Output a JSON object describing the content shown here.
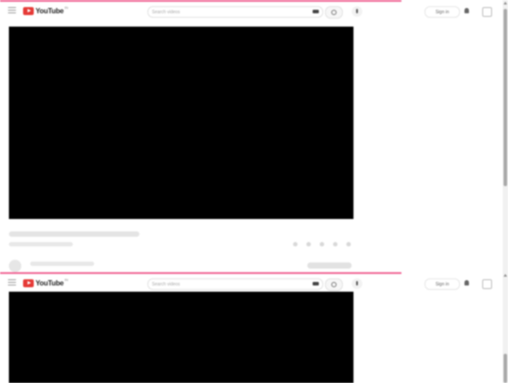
{
  "app": {
    "name": "YouTube",
    "country": "IN"
  },
  "search": {
    "placeholder": "Search videos"
  },
  "header": {
    "signin_label": "Sign in"
  },
  "colors": {
    "accent": "#f06292",
    "brand": "#e53935",
    "player": "#000000"
  },
  "icons": [
    "menu-icon",
    "search-icon",
    "keyboard-icon",
    "mic-icon",
    "bell-icon",
    "more-icon"
  ],
  "frames": [
    {
      "id": "capture-1",
      "state": "loading"
    },
    {
      "id": "capture-2",
      "state": "loading"
    }
  ]
}
